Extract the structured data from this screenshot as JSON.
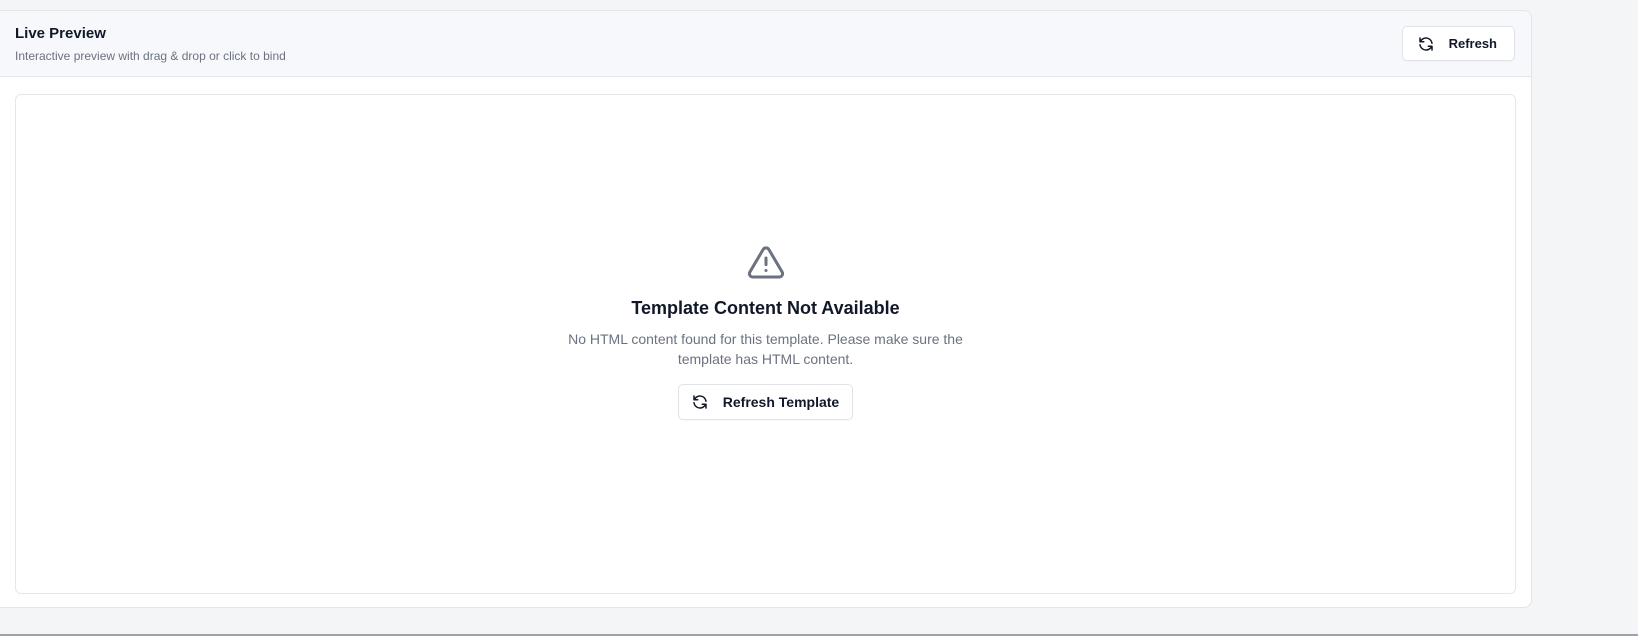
{
  "header": {
    "title": "Live Preview",
    "subtitle": "Interactive preview with drag & drop or click to bind",
    "refresh_label": "Refresh"
  },
  "empty_state": {
    "icon": "warning-triangle-icon",
    "title": "Template Content Not Available",
    "message": "No HTML content found for this template. Please make sure the template has HTML content.",
    "button_label": "Refresh Template"
  },
  "colors": {
    "text_primary": "#111827",
    "text_muted": "#6b7280",
    "icon_gray": "#6b7280",
    "border": "#e5e7eb",
    "header_bg": "#f6f8fb"
  }
}
